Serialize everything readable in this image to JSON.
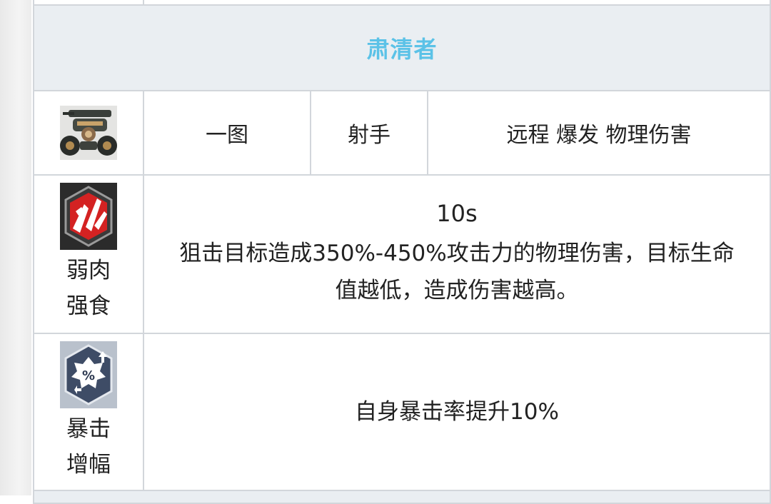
{
  "header": {
    "title": "肃清者"
  },
  "info_row": {
    "avatar_icon": "mech-turret-icon",
    "map": "一图",
    "role": "射手",
    "tags": "远程 爆发 物理伤害"
  },
  "skills": [
    {
      "icon": "shattered-crystal-skill-icon",
      "name_line1": "弱肉",
      "name_line2": "强食",
      "cooldown": "10s",
      "description": "狙击目标造成350%-450%攻击力的物理伤害，目标生命值越低，造成伤害越高。"
    },
    {
      "icon": "crit-percent-boost-icon",
      "name_line1": "暴击",
      "name_line2": "增幅",
      "description": "自身暴击率提升10%"
    }
  ],
  "colors": {
    "title": "#5bc2e7",
    "border": "#d2d6db",
    "header_bg": "#eaeef2"
  }
}
